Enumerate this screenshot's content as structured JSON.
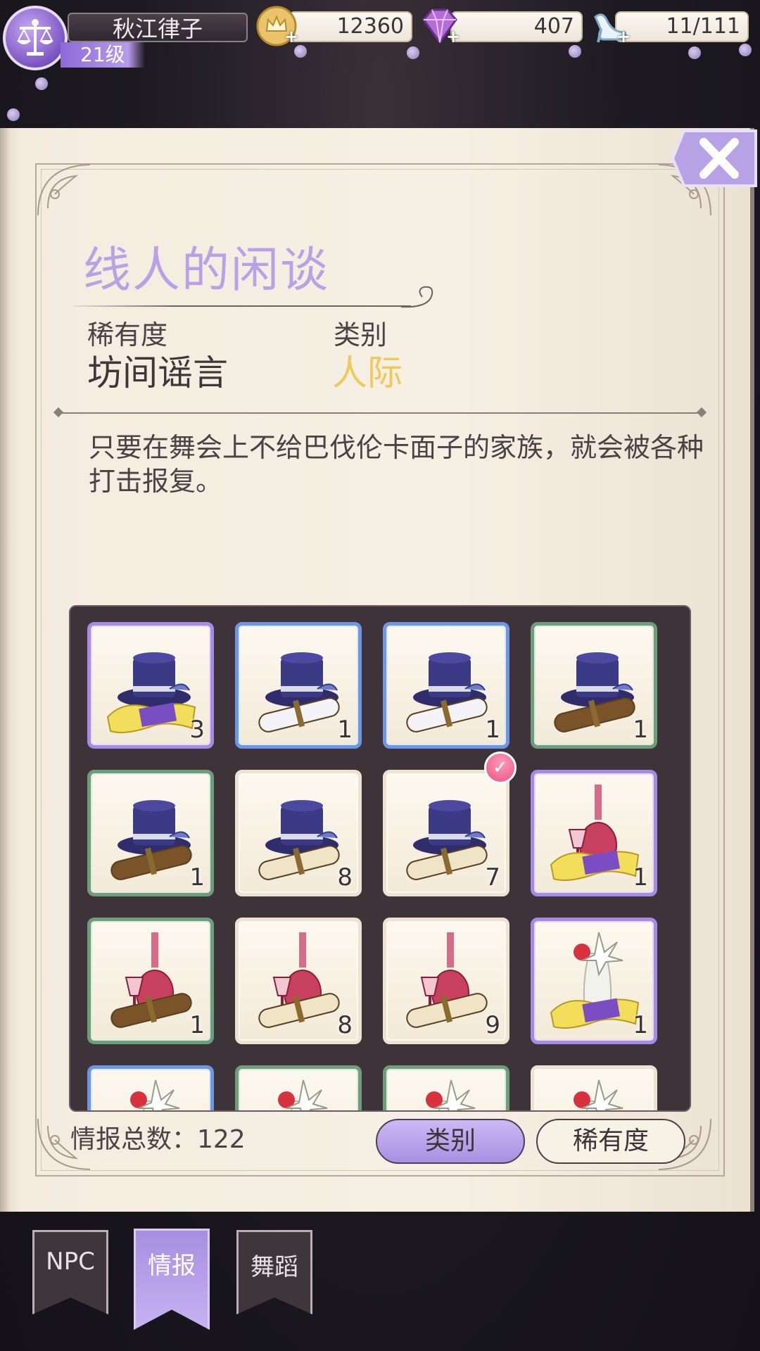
{
  "player": {
    "name": "秋江律子",
    "level": "21级"
  },
  "resources": {
    "gold": "12360",
    "gems": "407",
    "stamina": "11/111"
  },
  "item": {
    "title": "线人的闲谈",
    "rarity_label": "稀有度",
    "rarity_value": "坊间谣言",
    "category_label": "类别",
    "category_value": "人际",
    "description": "只要在舞会上不给巴伐伦卡面子的家族，就会被各种打击报复。"
  },
  "grid": {
    "items": [
      {
        "icon": "top-hat-with-silk-cloth-icon",
        "quantity": "3",
        "rarity_color": "purple"
      },
      {
        "icon": "top-hat-with-white-scroll-icon",
        "quantity": "1",
        "rarity_color": "blue"
      },
      {
        "icon": "top-hat-with-white-scroll-icon",
        "quantity": "1",
        "rarity_color": "blue"
      },
      {
        "icon": "top-hat-with-brown-scroll-icon",
        "quantity": "1",
        "rarity_color": "green"
      },
      {
        "icon": "top-hat-with-brown-scroll-icon",
        "quantity": "1",
        "rarity_color": "green"
      },
      {
        "icon": "top-hat-with-parchment-scroll-icon",
        "quantity": "8",
        "rarity_color": "white"
      },
      {
        "icon": "top-hat-with-parchment-scroll-icon",
        "quantity": "7",
        "rarity_color": "white",
        "selected": true
      },
      {
        "icon": "wine-bottle-with-silk-cloth-icon",
        "quantity": "1",
        "rarity_color": "purple"
      },
      {
        "icon": "wine-bottle-with-brown-scroll-icon",
        "quantity": "1",
        "rarity_color": "green"
      },
      {
        "icon": "wine-bottle-with-parchment-scroll-icon",
        "quantity": "8",
        "rarity_color": "white"
      },
      {
        "icon": "wine-bottle-with-parchment-scroll-icon",
        "quantity": "9",
        "rarity_color": "white"
      },
      {
        "icon": "flower-vase-with-silk-cloth-icon",
        "quantity": "1",
        "rarity_color": "purple"
      },
      {
        "icon": "flower-vase-icon",
        "quantity": "",
        "rarity_color": "blue"
      },
      {
        "icon": "flower-vase-icon",
        "quantity": "",
        "rarity_color": "green"
      },
      {
        "icon": "flower-vase-icon",
        "quantity": "",
        "rarity_color": "green"
      },
      {
        "icon": "flower-vase-icon",
        "quantity": "",
        "rarity_color": "white"
      }
    ]
  },
  "footer": {
    "total_text": "情报总数：122",
    "sort_category": "类别",
    "sort_rarity": "稀有度"
  },
  "tabs": [
    {
      "label": "NPC"
    },
    {
      "label": "情报"
    },
    {
      "label": "舞蹈"
    }
  ],
  "colors": {
    "accent_purple": "#b8a2e6",
    "category_gold": "#f0c95a",
    "rarity_purple": "#a78ae6",
    "rarity_blue": "#6d97e6",
    "rarity_green": "#6e9d7a"
  }
}
